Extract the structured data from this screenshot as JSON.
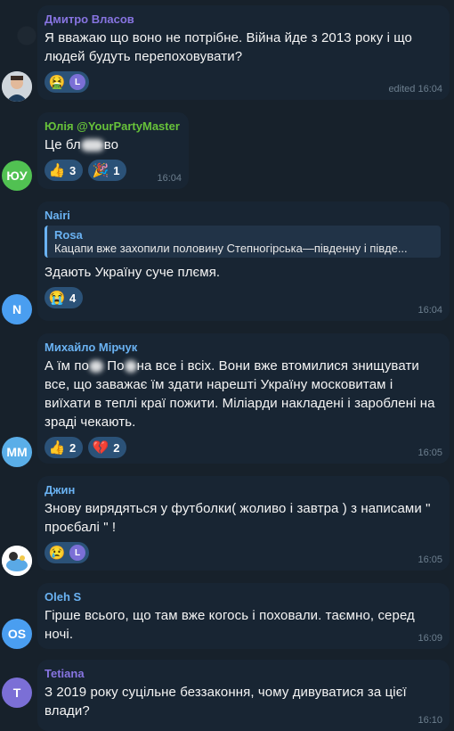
{
  "messages": [
    {
      "author": "Дмитро Власов",
      "author_color": "#8774e1",
      "text": "Я вважаю що воно не потрібне. Війна йде з 2013 року і що людей будуть перепоховувати?",
      "time": "edited 16:04",
      "reactions": [
        {
          "emoji": "🤮",
          "count": ""
        },
        {
          "emoji": "L",
          "count": ""
        }
      ],
      "avatar": {
        "kind": "photo"
      }
    },
    {
      "author": "Юлія @YourPartyMaster",
      "author_color": "#67c23a",
      "text_a": "Це бл",
      "text_b": "во",
      "time": "16:04",
      "reactions": [
        {
          "emoji": "👍",
          "count": "3"
        },
        {
          "emoji": "🎉",
          "count": "1"
        }
      ],
      "avatar": {
        "initials": "ЮУ",
        "color": "#51c152"
      }
    },
    {
      "author": "Nairi",
      "author_color": "#6ab2f2",
      "quote_author": "Rosa",
      "quote_text": "Кацапи вже захопили половину Степногірська—південну і півде...",
      "text": "Здають Україну суче плємя.",
      "time": "16:04",
      "reactions": [
        {
          "emoji": "😭",
          "count": "4"
        }
      ],
      "avatar": {
        "initials": "N",
        "color": "#4a9ef0"
      }
    },
    {
      "author": "Михайло Мірчук",
      "author_color": "#6ab2f2",
      "text_a": "А їм по",
      "text_b": " По",
      "text_c": "на все і всіх. Вони вже втомилися знищувати все, що заважає їм здати нарешті Україну московитам і виїхати в теплі краї пожити. Міліарди накладені і зароблені на зраді чекають.",
      "time": "16:05",
      "reactions": [
        {
          "emoji": "👍",
          "count": "2"
        },
        {
          "emoji": "💔",
          "count": "2"
        }
      ],
      "avatar": {
        "initials": "MM",
        "color": "#5aaee8"
      }
    },
    {
      "author": "Джин",
      "author_color": "#6ab2f2",
      "text": "Знову вирядяться у футболки( жоливо і завтра ) з написами \" проєбалі \" !",
      "time": "16:05",
      "reactions": [
        {
          "emoji": "😢",
          "count": ""
        },
        {
          "emoji": "L",
          "count": ""
        }
      ],
      "avatar": {
        "kind": "sticker"
      }
    },
    {
      "author": "Oleh S",
      "author_color": "#6ab2f2",
      "text": "Гірше всього, що там вже когось і поховали. таємно, серед ночі.",
      "time": "16:09",
      "reactions": [],
      "avatar": {
        "initials": "OS",
        "color": "#4a9ef0"
      }
    },
    {
      "author": "Tetiana",
      "author_color": "#8774e1",
      "text": "З 2019 року суцільне беззаконня, чому дивуватися за цієї влади?",
      "time": "16:10",
      "reactions": [],
      "avatar": {
        "initials": "T",
        "color": "#7b6fd6"
      }
    }
  ]
}
